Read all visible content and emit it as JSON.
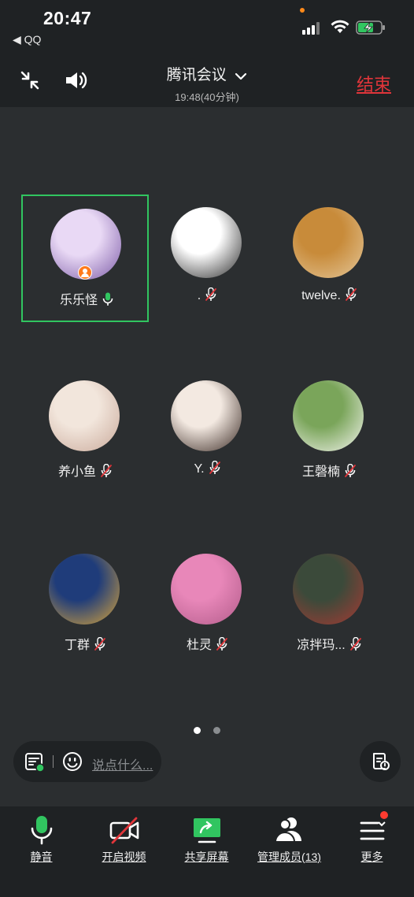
{
  "status_bar": {
    "time": "20:47",
    "back_app": "◀ QQ"
  },
  "header": {
    "title": "腾讯会议",
    "subtitle": "19:48(40分钟)",
    "end_label": "结束"
  },
  "participants": [
    {
      "name": "乐乐怪",
      "mic": "on",
      "host": true,
      "active": true,
      "avatar_colors": [
        "#e9d9f5",
        "#7b5aa6"
      ]
    },
    {
      "name": ".",
      "mic": "off",
      "host": false,
      "active": false,
      "avatar_colors": [
        "#ffffff",
        "#2a2a2a"
      ]
    },
    {
      "name": "twelve.",
      "mic": "off",
      "host": false,
      "active": false,
      "avatar_colors": [
        "#c88b3a",
        "#e4c79a"
      ]
    },
    {
      "name": "养小鱼",
      "mic": "off",
      "host": false,
      "active": false,
      "avatar_colors": [
        "#f2e6dc",
        "#c9a99a"
      ]
    },
    {
      "name": "Y.",
      "mic": "off",
      "host": false,
      "active": false,
      "avatar_colors": [
        "#f3e9e1",
        "#3a2a24"
      ]
    },
    {
      "name": "王磬楠",
      "mic": "off",
      "host": false,
      "active": false,
      "avatar_colors": [
        "#7aa55a",
        "#f5f5f0"
      ]
    },
    {
      "name": "丁群",
      "mic": "off",
      "host": false,
      "active": false,
      "avatar_colors": [
        "#1f3c7a",
        "#d9a53a"
      ]
    },
    {
      "name": "杜灵",
      "mic": "off",
      "host": false,
      "active": false,
      "avatar_colors": [
        "#e887b9",
        "#b25c8a"
      ]
    },
    {
      "name": "凉拌玛...",
      "mic": "off",
      "host": false,
      "active": false,
      "avatar_colors": [
        "#3b4a3a",
        "#a83a34"
      ]
    }
  ],
  "pager": {
    "pages": 2,
    "current": 1
  },
  "chat": {
    "placeholder": "说点什么..."
  },
  "toolbar": {
    "mute_label": "静音",
    "video_label": "开启视频",
    "share_label": "共享屏幕",
    "members_label": "管理成员(13)",
    "more_label": "更多"
  },
  "colors": {
    "background": "#2b2e30",
    "bar": "#1f2224",
    "accent_green": "#31c560",
    "end_red": "#e0353a",
    "muted_red": "#e0353a"
  }
}
